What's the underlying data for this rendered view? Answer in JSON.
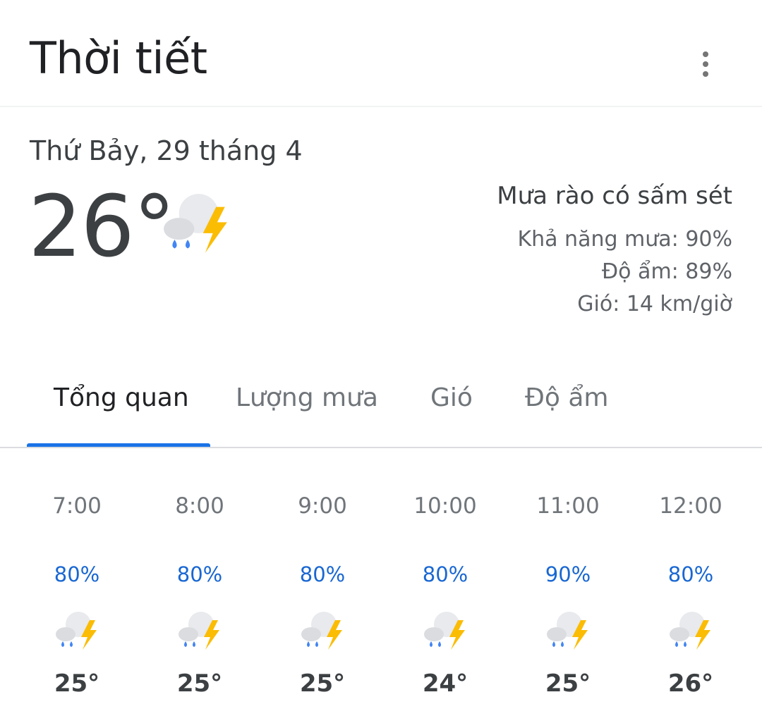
{
  "header": {
    "title": "Thời tiết",
    "menu_icon": "more-vert-icon"
  },
  "current": {
    "date": "Thứ Bảy, 29 tháng 4",
    "temperature": "26°",
    "icon": "thunderstorm-rain-icon",
    "condition": "Mưa rào có sấm sét",
    "precipitation": "Khả năng mưa: 90%",
    "humidity": "Độ ẩm: 89%",
    "wind": "Gió: 14 km/giờ"
  },
  "tabs": [
    {
      "label": "Tổng quan",
      "active": true
    },
    {
      "label": "Lượng mưa",
      "active": false
    },
    {
      "label": "Gió",
      "active": false
    },
    {
      "label": "Độ ẩm",
      "active": false
    }
  ],
  "hourly": [
    {
      "time": "7:00",
      "precip": "80%",
      "temp": "25°",
      "icon": "thunderstorm-rain-icon"
    },
    {
      "time": "8:00",
      "precip": "80%",
      "temp": "25°",
      "icon": "thunderstorm-rain-icon"
    },
    {
      "time": "9:00",
      "precip": "80%",
      "temp": "25°",
      "icon": "thunderstorm-rain-icon"
    },
    {
      "time": "10:00",
      "precip": "80%",
      "temp": "24°",
      "icon": "thunderstorm-rain-icon"
    },
    {
      "time": "11:00",
      "precip": "90%",
      "temp": "25°",
      "icon": "thunderstorm-rain-icon"
    },
    {
      "time": "12:00",
      "precip": "80%",
      "temp": "26°",
      "icon": "thunderstorm-rain-icon"
    }
  ],
  "colors": {
    "accent": "#1a73e8",
    "precip_text": "#1967d2",
    "bolt": "#fbbc04",
    "rain_drop": "#4285f4",
    "cloud_light": "#e8eaed",
    "cloud_dark": "#dadce0"
  }
}
